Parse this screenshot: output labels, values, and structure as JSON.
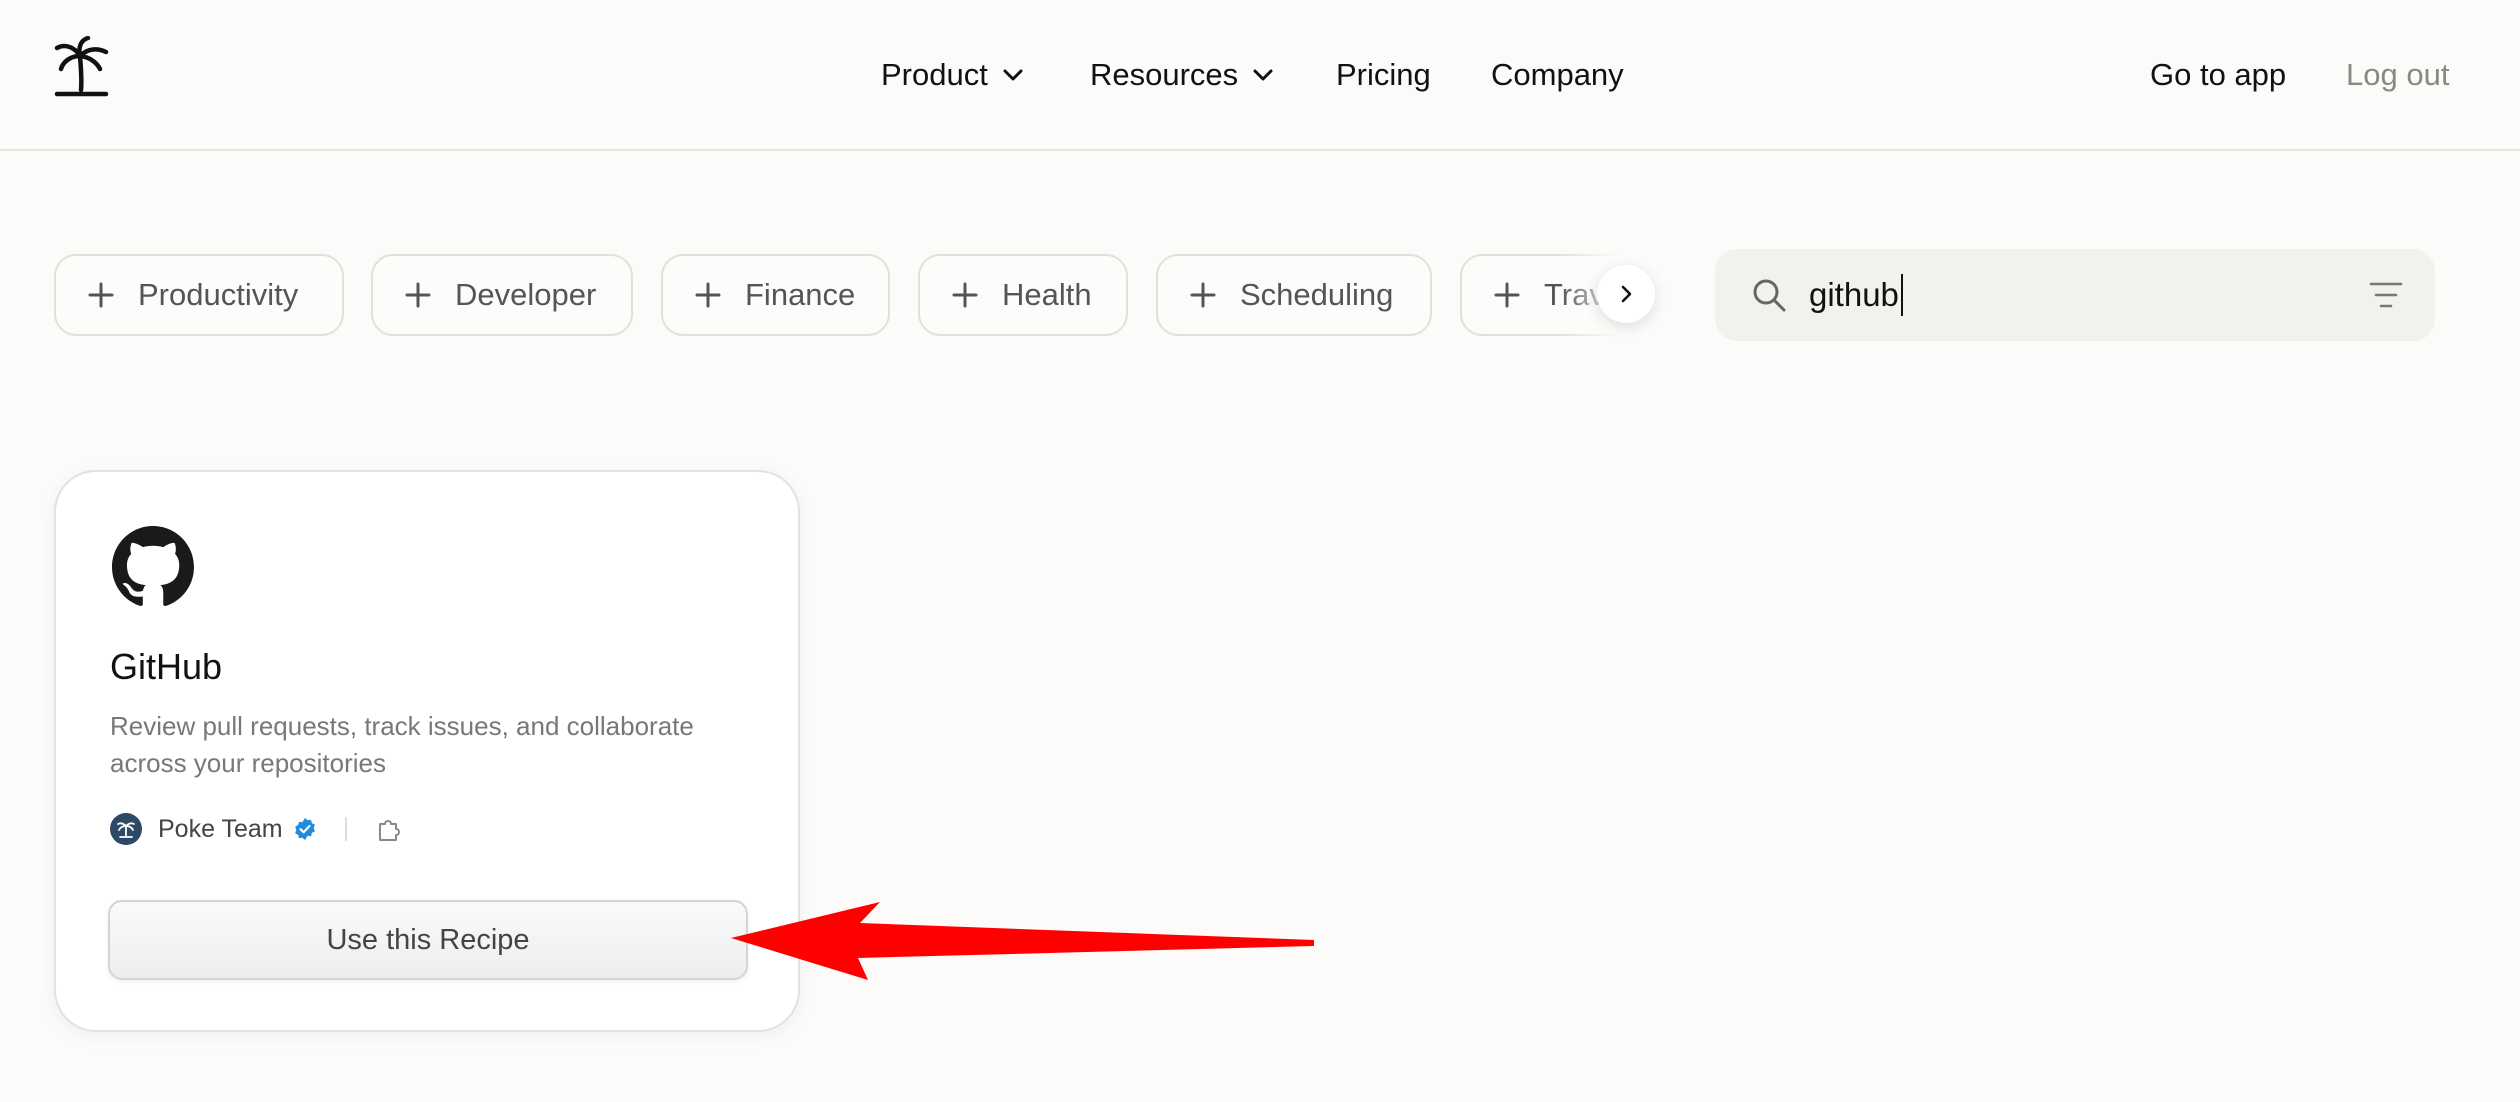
{
  "header": {
    "logo_icon": "palm-tree-icon",
    "nav": [
      {
        "label": "Product",
        "has_dropdown": true
      },
      {
        "label": "Resources",
        "has_dropdown": true
      },
      {
        "label": "Pricing",
        "has_dropdown": false
      },
      {
        "label": "Company",
        "has_dropdown": false
      }
    ],
    "go_to_app": "Go to app",
    "log_out": "Log out"
  },
  "categories": [
    {
      "label": "Productivity",
      "icon": "plus-icon"
    },
    {
      "label": "Developer",
      "icon": "plus-icon"
    },
    {
      "label": "Finance",
      "icon": "plus-icon"
    },
    {
      "label": "Health",
      "icon": "plus-icon"
    },
    {
      "label": "Scheduling",
      "icon": "plus-icon"
    },
    {
      "label": "Travel",
      "icon": "plus-icon"
    }
  ],
  "search": {
    "value": "github",
    "icon": "search-icon",
    "filter_icon": "filter-icon"
  },
  "results": [
    {
      "icon": "github-icon",
      "title": "GitHub",
      "description": "Review pull requests, track issues, and collaborate across your repositories",
      "author": "Poke Team",
      "verified": true,
      "button_label": "Use this Recipe"
    }
  ],
  "colors": {
    "background": "#fcfbf9",
    "annotation_arrow": "#ff0000",
    "verified_badge": "#1d8ce0"
  }
}
